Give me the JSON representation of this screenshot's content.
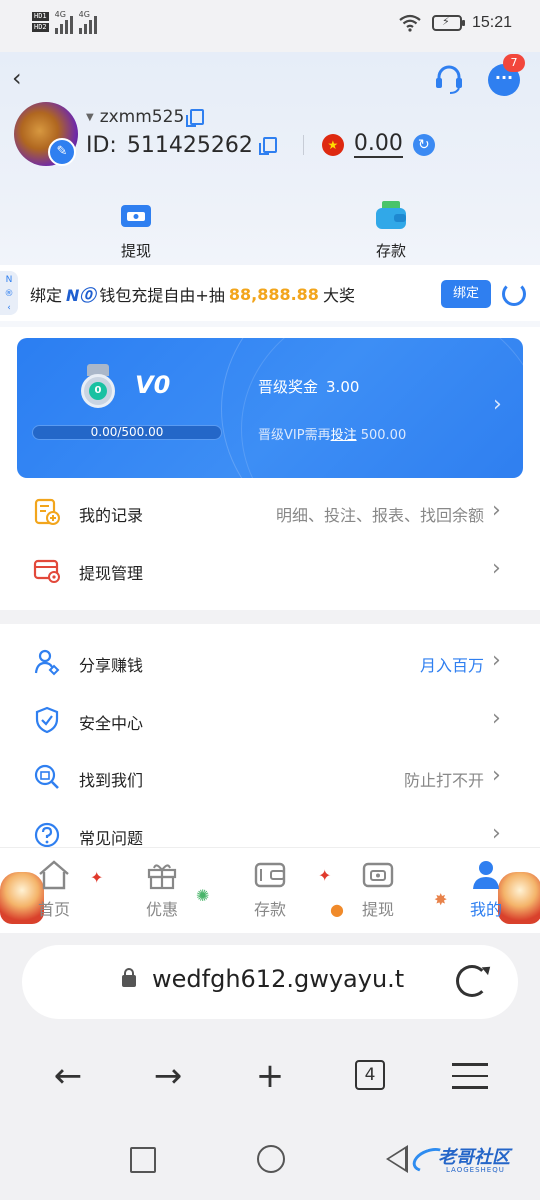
{
  "status_bar": {
    "hd1": "HD1",
    "hd2": "HD2",
    "net1": "4G",
    "net2": "4G",
    "time": "15:21"
  },
  "header": {
    "back_icon": "chevron-left-icon",
    "support_icon": "headset-icon",
    "chat_icon": "chat-bubble-icon",
    "notification_count": "7",
    "username": "zxmm525",
    "id_label": "ID:",
    "id_value": "511425262",
    "balance": "0.00",
    "flag": "cn-flag-icon"
  },
  "quick_actions": [
    {
      "label": "提现",
      "icon": "withdraw-card-icon"
    },
    {
      "label": "存款",
      "icon": "wallet-money-icon"
    }
  ],
  "promo": {
    "side_tab": "N",
    "prefix": "绑定",
    "brand": "N",
    "middle": "钱包充提自由+抽",
    "amount": "88,888.88",
    "suffix": "大奖",
    "button": "绑定"
  },
  "vip": {
    "badge_value": "0",
    "level": "V0",
    "progress_text": "0.00/500.00",
    "progress_fraction": 0,
    "bonus_label": "晋级奖金",
    "bonus_value": "3.00",
    "need_prefix": "晋级VIP需再",
    "need_link": "投注",
    "need_value": "500.00"
  },
  "menu": [
    {
      "label": "我的记录",
      "right": "明细、投注、报表、找回余额",
      "icon": "record-doc-icon"
    },
    {
      "label": "提现管理",
      "right": "",
      "icon": "card-settings-icon"
    },
    {
      "label": "分享赚钱",
      "right": "月入百万",
      "icon": "share-user-icon"
    },
    {
      "label": "安全中心",
      "right": "",
      "icon": "shield-check-icon"
    },
    {
      "label": "找到我们",
      "right": "防止打不开",
      "icon": "search-doc-icon"
    },
    {
      "label": "常见问题",
      "right": "",
      "icon": "question-circle-icon"
    }
  ],
  "bottom_nav": [
    {
      "label": "首页",
      "icon": "home-icon"
    },
    {
      "label": "优惠",
      "icon": "gift-icon"
    },
    {
      "label": "存款",
      "icon": "wallet-icon"
    },
    {
      "label": "提现",
      "icon": "withdraw-ticket-icon"
    },
    {
      "label": "我的",
      "icon": "user-icon"
    }
  ],
  "browser": {
    "url": "wedfgh612.gwyayu.t",
    "tabs_count": "4"
  },
  "watermark": {
    "text": "老哥社区",
    "sub": "LAOGESHEQU"
  },
  "colors": {
    "accent": "#2f7ff0",
    "gold": "#f2a51c",
    "badge_red": "#f2473c"
  }
}
